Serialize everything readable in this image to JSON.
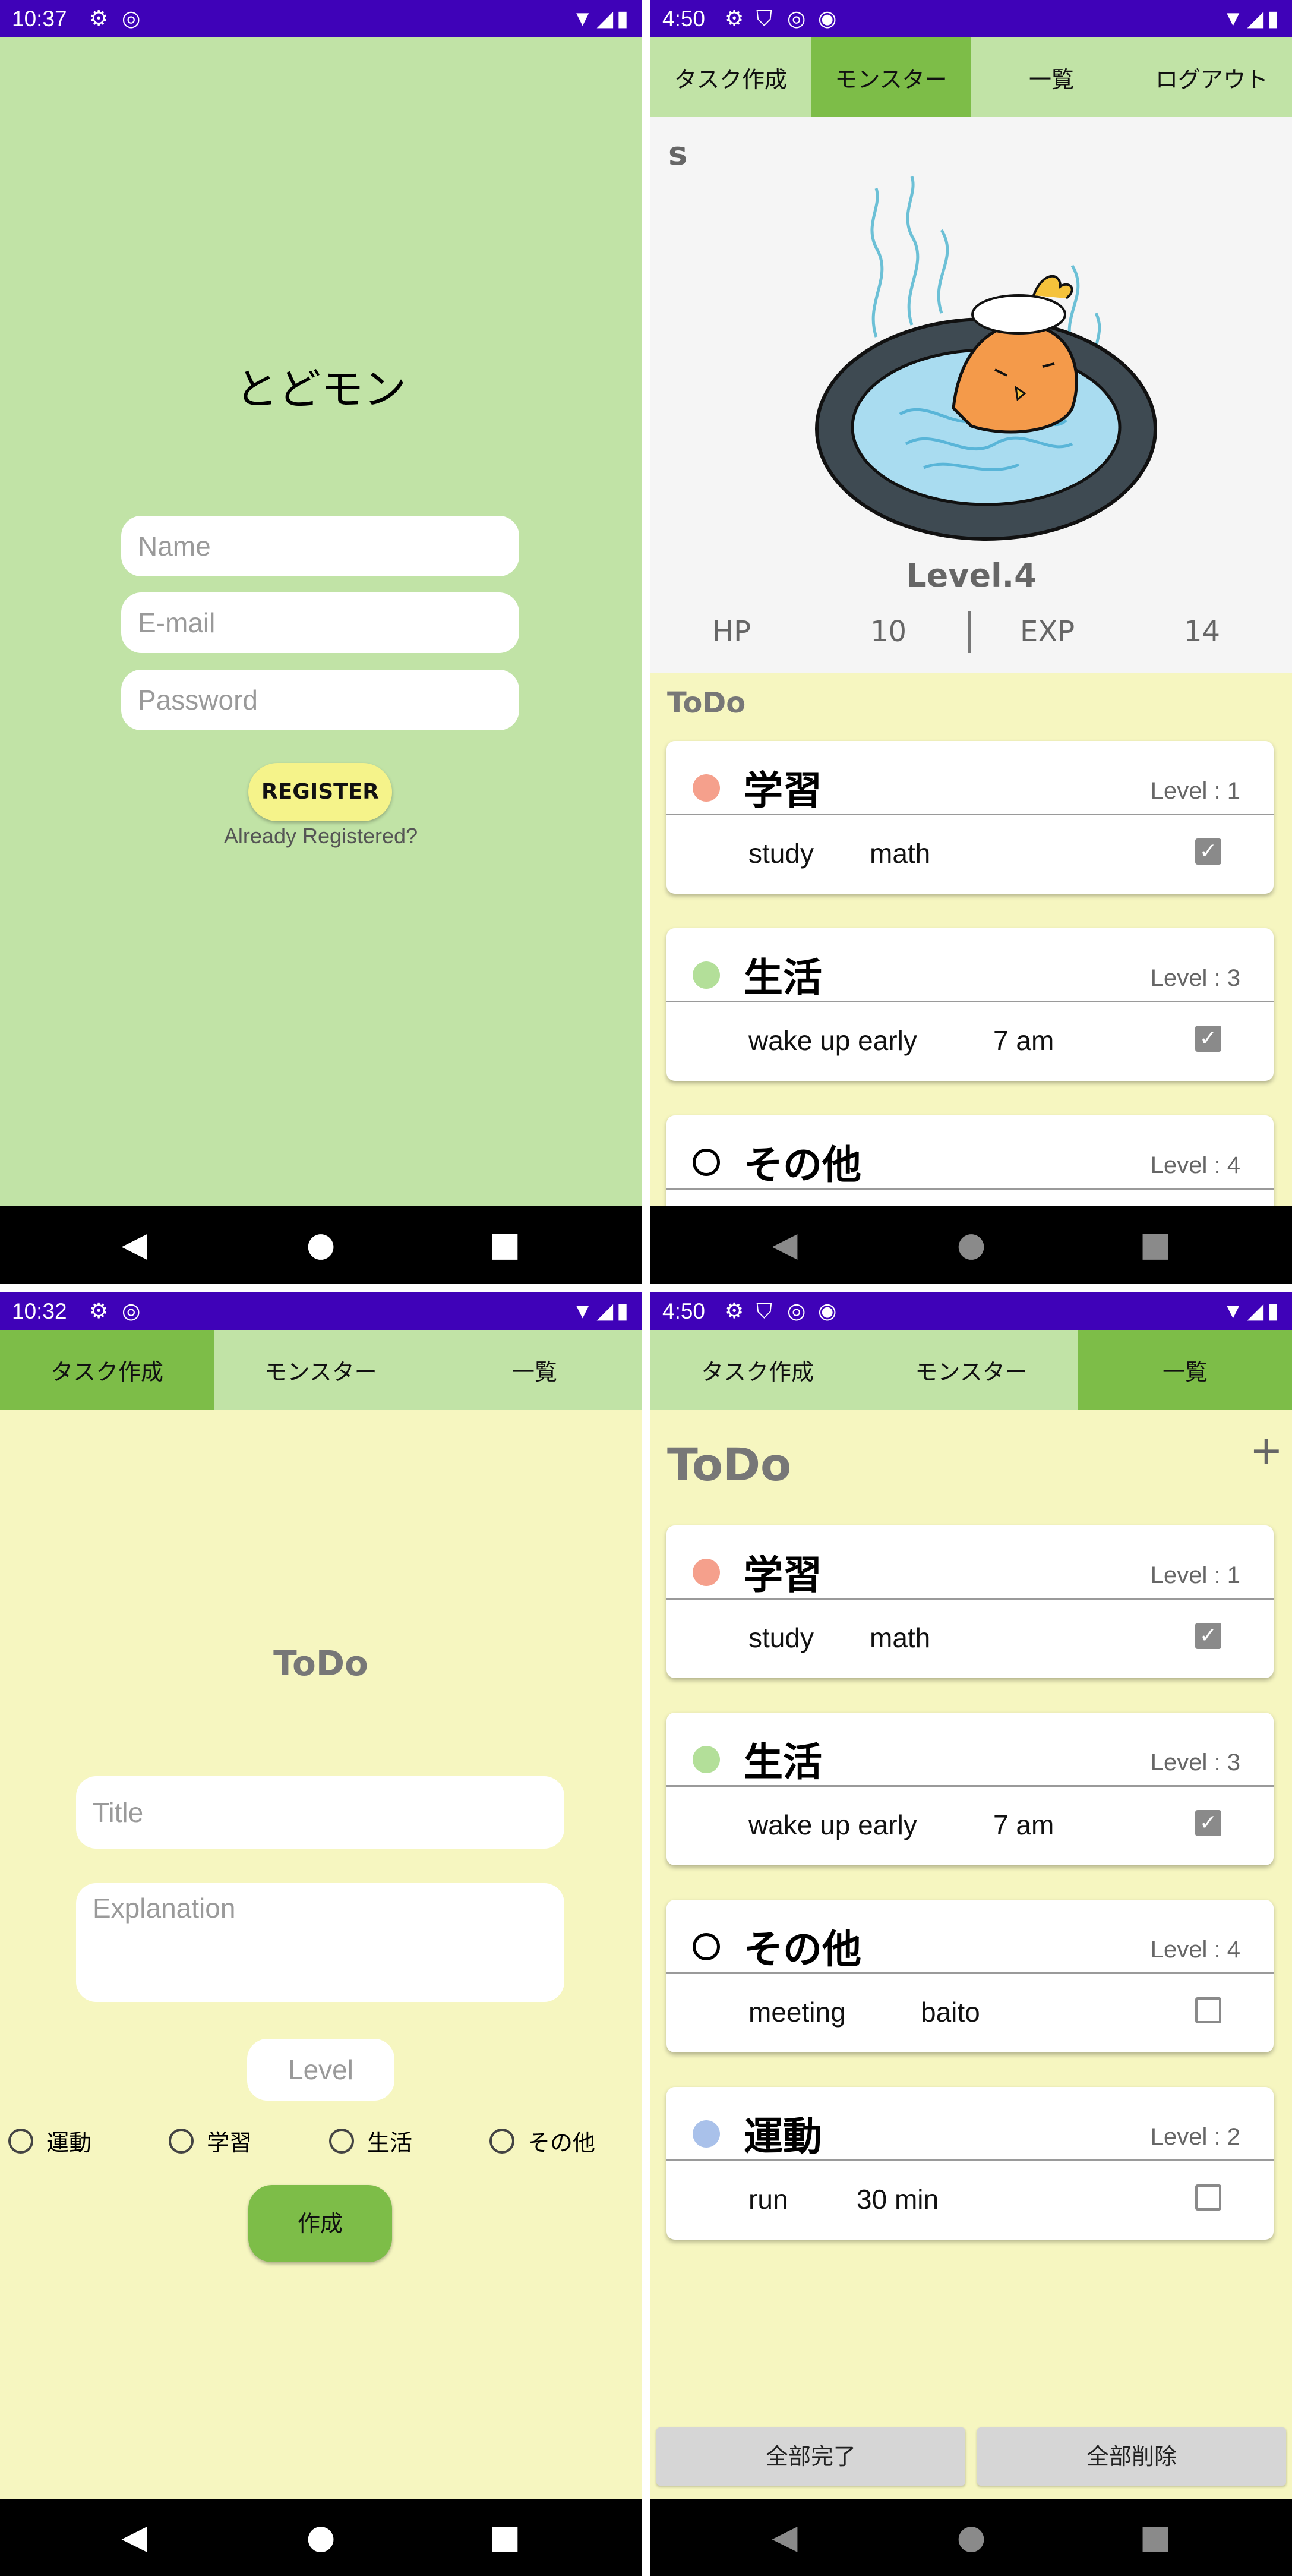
{
  "screen_register": {
    "status_time": "10:37",
    "app_title": "とどモン",
    "name_placeholder": "Name",
    "email_placeholder": "E-mail",
    "password_placeholder": "Password",
    "register_label": "REGISTER",
    "already_registered": "Already Registered?"
  },
  "screen_monster": {
    "status_time": "4:50",
    "tabs": [
      "タスク作成",
      "モンスター",
      "一覧",
      "ログアウト"
    ],
    "active_tab": 1,
    "monster_name": "s",
    "level": "Level.4",
    "hp_label": "HP",
    "hp_value": "10",
    "exp_label": "EXP",
    "exp_value": "14",
    "todo_heading": "ToDo",
    "cards": [
      {
        "category": "学習",
        "level": "Level : 1",
        "title": "study",
        "detail": "math",
        "done": true,
        "dot_color": "#f5a08c"
      },
      {
        "category": "生活",
        "level": "Level : 3",
        "title": "wake up early",
        "detail": "7 am",
        "done": true,
        "dot_color": "#b3df99"
      },
      {
        "category": "その他",
        "level": "Level : 4",
        "dot_color": "ring"
      }
    ]
  },
  "screen_create": {
    "status_time": "10:32",
    "tabs": [
      "タスク作成",
      "モンスター",
      "一覧"
    ],
    "active_tab": 0,
    "heading": "ToDo",
    "title_placeholder": "Title",
    "explanation_placeholder": "Explanation",
    "level_placeholder": "Level",
    "radios": [
      "運動",
      "学習",
      "生活",
      "その他"
    ],
    "create_label": "作成"
  },
  "screen_list": {
    "status_time": "4:50",
    "tabs": [
      "タスク作成",
      "モンスター",
      "一覧"
    ],
    "active_tab": 2,
    "heading": "ToDo",
    "add_icon": "+",
    "cards": [
      {
        "category": "学習",
        "level": "Level : 1",
        "title": "study",
        "detail": "math",
        "done": true,
        "dot_color": "#f5a08c"
      },
      {
        "category": "生活",
        "level": "Level : 3",
        "title": "wake up early",
        "detail": "7 am",
        "done": true,
        "dot_color": "#b3df99"
      },
      {
        "category": "その他",
        "level": "Level : 4",
        "title": "meeting",
        "detail": "baito",
        "done": false,
        "dot_color": "ring"
      },
      {
        "category": "運動",
        "level": "Level : 2",
        "title": "run",
        "detail": "30 min",
        "done": false,
        "dot_color": "#a9c1ea"
      }
    ],
    "complete_all_label": "全部完了",
    "delete_all_label": "全部削除"
  },
  "colors": {
    "status_bar": "#3f02b8",
    "tab_bg": "#c1e3a6",
    "tab_active": "#7dbd48",
    "content_bg": "#f6f6c0",
    "register_button": "#f5f38a",
    "create_button": "#7dbd48"
  }
}
